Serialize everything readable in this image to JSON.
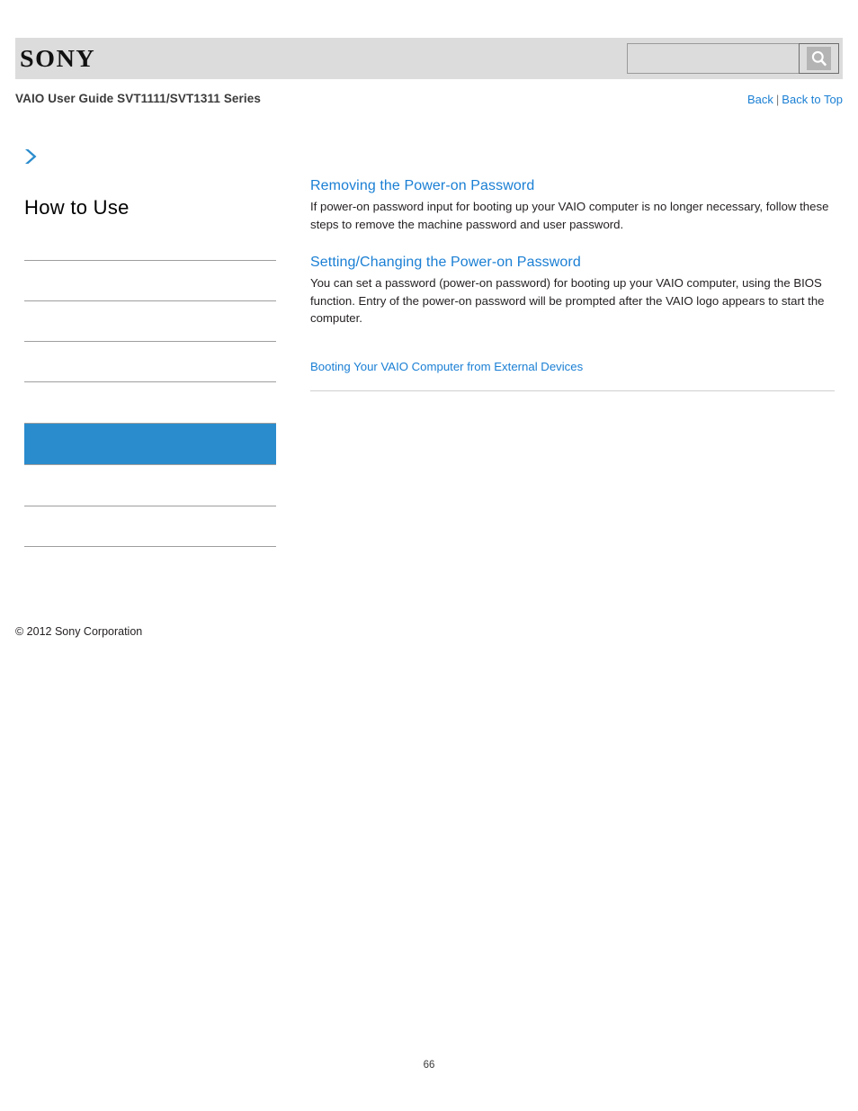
{
  "header": {
    "logo_text": "SONY",
    "search": {
      "value": "",
      "placeholder": "",
      "icon": "search-icon",
      "button_label": ""
    }
  },
  "title_bar": {
    "guide_title": "VAIO User Guide SVT1111/SVT1311 Series",
    "back_label": "Back",
    "separator": "|",
    "back_to_top_label": "Back to Top"
  },
  "sidebar": {
    "expand_icon": "chevron-right-icon",
    "heading": "How to Use",
    "items": [
      {
        "label": "",
        "selected": false
      },
      {
        "label": "",
        "selected": false
      },
      {
        "label": "",
        "selected": false
      },
      {
        "label": "",
        "selected": false
      },
      {
        "label": "",
        "selected": false
      },
      {
        "label": "",
        "selected": true
      },
      {
        "label": "",
        "selected": false
      },
      {
        "label": "",
        "selected": false
      }
    ],
    "copyright": "© 2012 Sony Corporation"
  },
  "main": {
    "sections": [
      {
        "title": "Removing the Power-on Password",
        "body": "If power-on password input for booting up your VAIO computer is no longer necessary, follow these steps to remove the machine password and user password."
      },
      {
        "title": "Setting/Changing the Power-on Password",
        "body": "You can set a password (power-on password) for booting up your VAIO computer, using the BIOS function. Entry of the power-on password will be prompted after the VAIO logo appears to start the computer."
      }
    ],
    "trailing_link": "Booting Your VAIO Computer from External Devices"
  },
  "footer": {
    "page_number": "66"
  },
  "colors": {
    "accent_blue": "#1a7fd4",
    "selected_blue": "#2a8ccd",
    "header_gray": "#dcdcdc",
    "divider_gray": "#9e9e9e",
    "rule_gray": "#cfcfcf"
  }
}
